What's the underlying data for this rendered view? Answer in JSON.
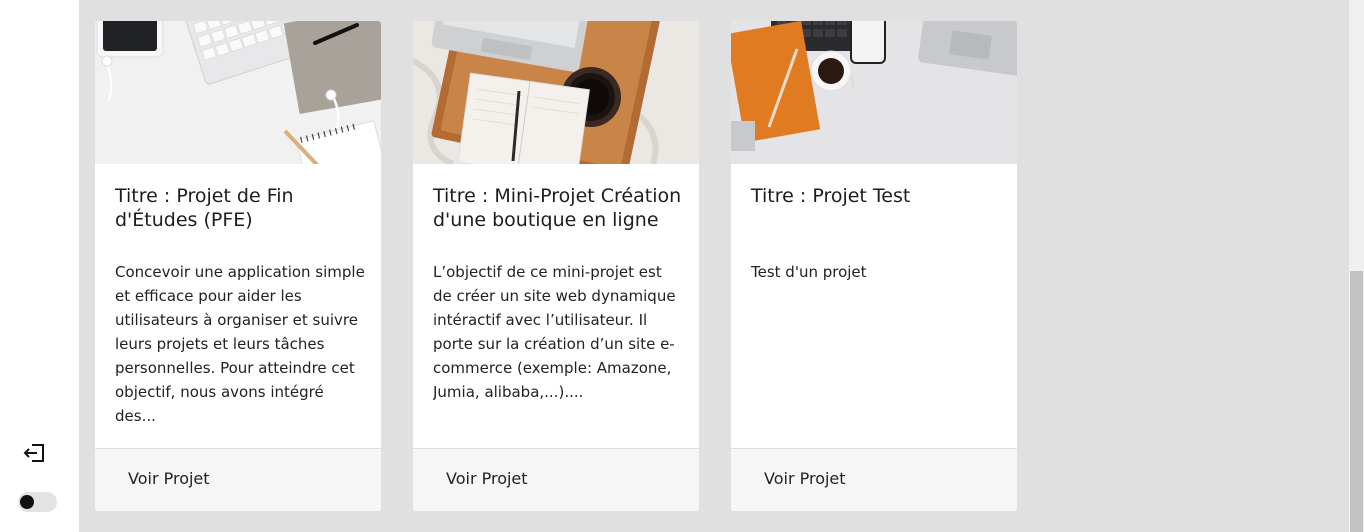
{
  "sidebar": {
    "logout_icon": "logout-icon",
    "theme_toggle": {
      "state": "off"
    }
  },
  "projects": [
    {
      "title": "Titre : Projet de Fin d'Études (PFE)",
      "description": "Concevoir une application simple et efficace pour aider les utilisateurs à organiser et suivre leurs projets et leurs tâches personnelles. Pour atteindre cet objectif, nous avons intégré des...",
      "link_label": "Voir Projet",
      "image": "desk-keyboard-phone-notebook"
    },
    {
      "title": "Titre : Mini-Projet Création d'une boutique en ligne",
      "description": "L’objectif de ce mini-projet est de créer un site web dynamique intéractif avec l’utilisateur. Il porte sur la création d’un site e-commerce (exemple: Amazone, Jumia, alibaba,...)....",
      "link_label": "Voir Projet",
      "image": "laptop-coffee-tray-bed"
    },
    {
      "title": "Titre : Projet Test",
      "description": "Test d'un projet",
      "link_label": "Voir Projet",
      "image": "desk-orange-notebook-coffee-laptop"
    }
  ],
  "colors": {
    "background": "#e0e0e0",
    "card": "#ffffff",
    "card_footer": "#f6f6f6",
    "text": "#1d1d1d"
  }
}
